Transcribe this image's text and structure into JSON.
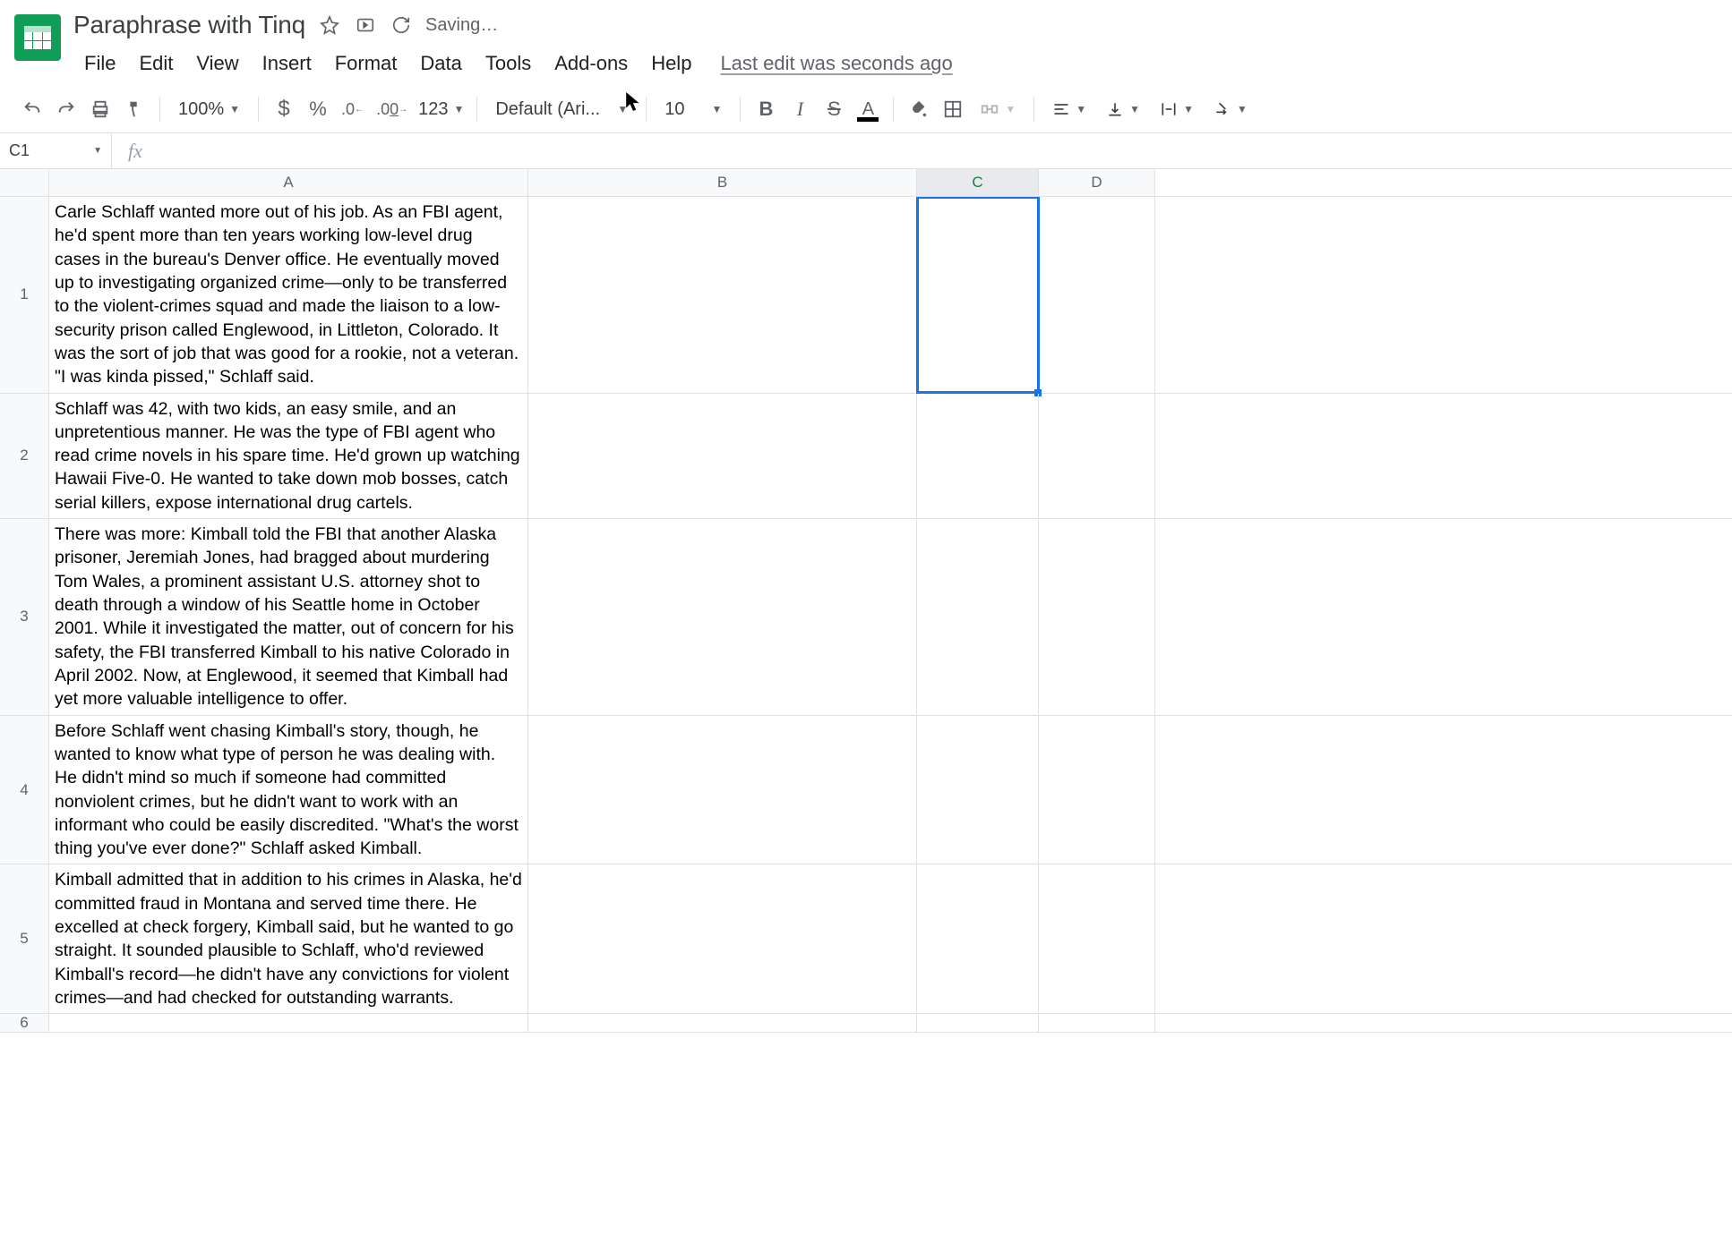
{
  "doc": {
    "title": "Paraphrase with Tinq"
  },
  "status": {
    "saving": "Saving…",
    "last_edit": "Last edit was seconds ago"
  },
  "menu": {
    "file": "File",
    "edit": "Edit",
    "view": "View",
    "insert": "Insert",
    "format": "Format",
    "data": "Data",
    "tools": "Tools",
    "addons": "Add-ons",
    "help": "Help"
  },
  "toolbar": {
    "zoom": "100%",
    "font": "Default (Ari...",
    "font_size": "10",
    "more_formats": "123",
    "decrease_dec": ".0",
    "increase_dec": ".00"
  },
  "namebox": {
    "ref": "C1"
  },
  "cols": {
    "a": "A",
    "b": "B",
    "c": "C",
    "d": "D"
  },
  "rows": [
    {
      "num": "1",
      "a": "Carle Schlaff wanted more out of his job. As an FBI agent, he'd spent more than ten years working low-level drug cases in the bureau's Denver office. He eventually moved up to investigating organized crime—only to be transferred to the violent-crimes squad and made the liaison to a low-security prison called Englewood, in Littleton, Colorado. It was the sort of job that was good for a rookie, not a veteran. \"I was kinda pissed,\" Schlaff said."
    },
    {
      "num": "2",
      "a": "Schlaff was 42, with two kids, an easy smile, and an unpretentious manner. He was the type of FBI agent who read crime novels in his spare time. He'd grown up watching Hawaii Five-0. He wanted to take down mob bosses, catch serial killers, expose international drug cartels."
    },
    {
      "num": "3",
      "a": "There was more: Kimball told the FBI that another Alaska prisoner, Jeremiah Jones, had bragged about murdering Tom Wales, a prominent assistant U.S. attorney shot to death through a window of his Seattle home in October 2001. While it investigated the matter, out of concern for his safety, the FBI transferred Kimball to his native Colorado in April 2002. Now, at Englewood, it seemed that Kimball had yet more valuable intelligence to offer."
    },
    {
      "num": "4",
      "a": "Before Schlaff went chasing Kimball's story, though, he wanted to know what type of person he was dealing with. He didn't mind so much if someone had committed nonviolent crimes, but he didn't want to work with an informant who could be easily discredited. \"What's the worst thing you've ever done?\" Schlaff asked Kimball."
    },
    {
      "num": "5",
      "a": "Kimball admitted that in addition to his crimes in Alaska, he'd committed fraud in Montana and served time there. He excelled at check forgery, Kimball said, but he wanted to go straight. It sounded plausible to Schlaff, who'd reviewed Kimball's record—he didn't have any convictions for violent crimes—and had checked for outstanding warrants."
    },
    {
      "num": "6",
      "a": ""
    }
  ],
  "selected": {
    "row": 0,
    "col": "c"
  }
}
